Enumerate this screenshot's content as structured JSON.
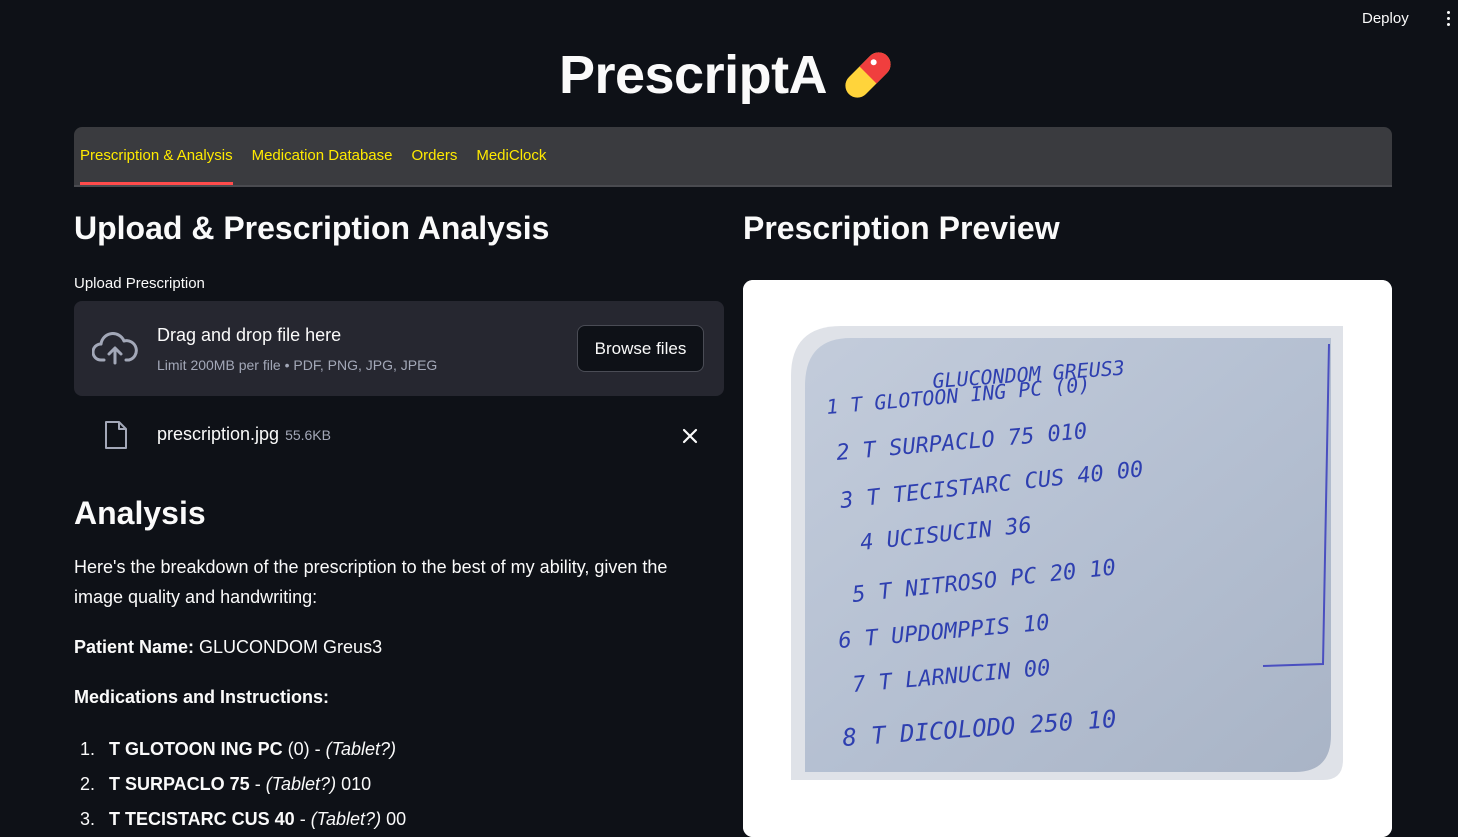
{
  "header": {
    "deploy_label": "Deploy"
  },
  "app": {
    "title": "PrescriptA"
  },
  "tabs": [
    {
      "label": "Prescription & Analysis",
      "active": true
    },
    {
      "label": "Medication Database",
      "active": false
    },
    {
      "label": "Orders",
      "active": false
    },
    {
      "label": "MediClock",
      "active": false
    }
  ],
  "upload": {
    "heading": "Upload & Prescription Analysis",
    "label": "Upload Prescription",
    "drop_title": "Drag and drop file here",
    "drop_limits": "Limit 200MB per file • PDF, PNG, JPG, JPEG",
    "browse_label": "Browse files",
    "file_name": "prescription.jpg",
    "file_size": "55.6KB"
  },
  "analysis": {
    "heading": "Analysis",
    "intro": "Here's the breakdown of the prescription to the best of my ability, given the image quality and handwriting:",
    "patient_label": "Patient Name:",
    "patient_value": " GLUCONDOM Greus3",
    "medications_heading": "Medications and Instructions:",
    "medications": [
      {
        "num": "1.",
        "name": "T GLOTOON ING PC",
        "detail": " (0) - ",
        "form": "(Tablet?)",
        "tail": ""
      },
      {
        "num": "2.",
        "name": "T SURPACLO 75",
        "detail": " - ",
        "form": "(Tablet?)",
        "tail": " 010"
      },
      {
        "num": "3.",
        "name": "T TECISTARC CUS 40",
        "detail": " - ",
        "form": "(Tablet?)",
        "tail": " 00"
      }
    ]
  },
  "preview": {
    "heading": "Prescription Preview",
    "handwritten_lines": [
      "GLUCONDOM GREUS3",
      "1 T GLOTOON ING PC (0)",
      "2 T SURPACLO 75 010",
      "3 T TECISTARC CUS 40 00",
      "4 UCISUCIN 36",
      "5 T NITROSO PC 20 10",
      "6 T UPDOMPPIS 10",
      "7 T LARNUCIN 00",
      "8 T DICOLODO 250 10"
    ]
  },
  "colors": {
    "background": "#0e1117",
    "tab_bar": "#3a3b3f",
    "tab_text": "#ffea00",
    "active_tab_underline": "#ff4b4b",
    "dropzone": "#262730",
    "ink": "#2e3fb0",
    "paper": "#b9c4d6"
  },
  "icons": [
    "cloud-upload-icon",
    "file-icon",
    "close-icon",
    "pill-icon",
    "kebab-menu-icon"
  ]
}
